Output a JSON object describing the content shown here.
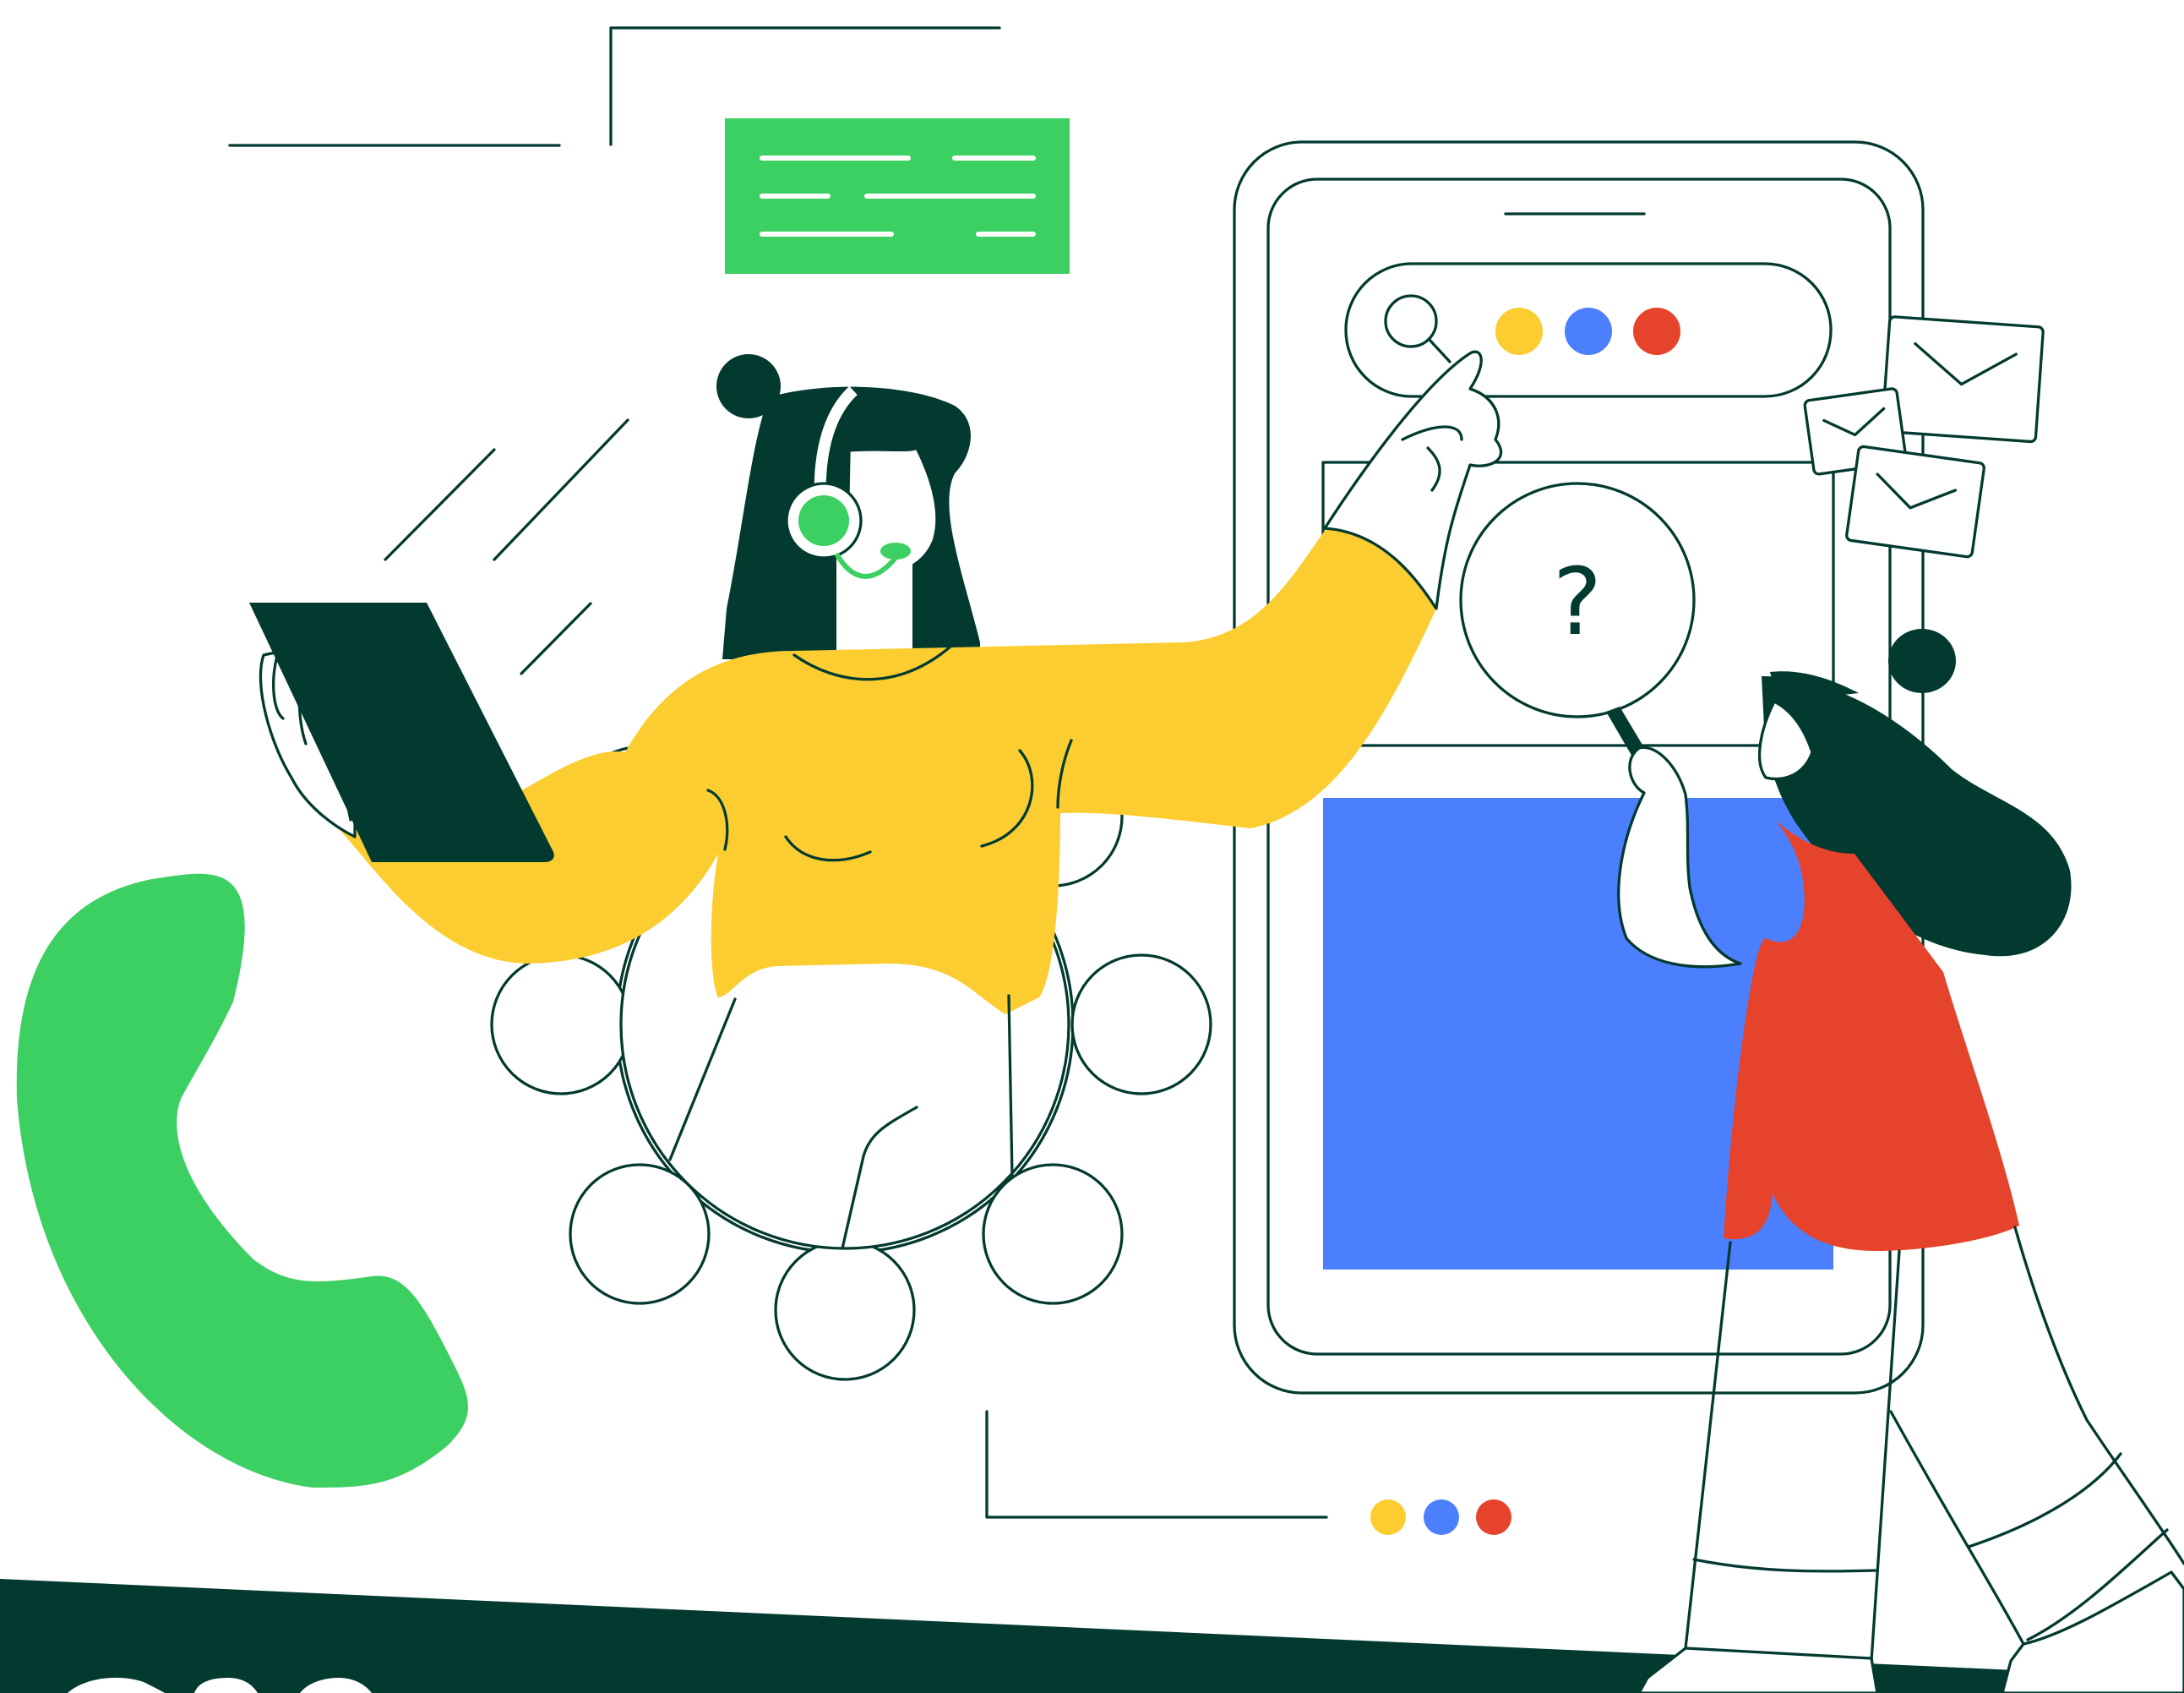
{
  "illustration": {
    "subject": "customer-support",
    "colors": {
      "dark_green": "#023a30",
      "green": "#3ccf62",
      "yellow": "#fccd31",
      "blue": "#4b7ffd",
      "red": "#e5432c",
      "white": "#ffffff"
    },
    "icons": [
      "phone-handset-icon",
      "gear-icon",
      "tablet-icon",
      "smartphone-icon",
      "search-icon",
      "magnifying-glass-icon",
      "question-mark-icon",
      "envelope-icon",
      "headset-icon",
      "chat-bubble-icon"
    ],
    "search_bar": {
      "dots": [
        "#fccd31",
        "#4b7ffd",
        "#e5432c"
      ]
    },
    "bottom_dots": [
      "#fccd31",
      "#4b7ffd",
      "#e5432c"
    ],
    "magnifier_glyph": "?"
  }
}
